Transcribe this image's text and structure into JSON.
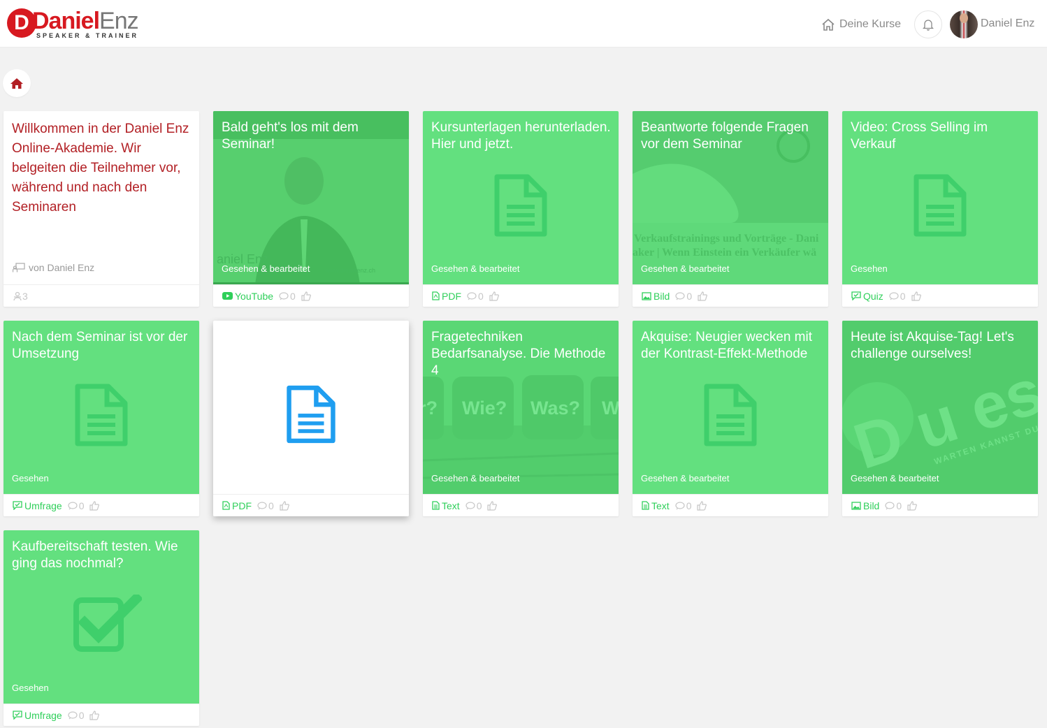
{
  "header": {
    "logo_main": "Daniel",
    "logo_enz": "Enz",
    "logo_sub": "SPEAKER & TRAINER",
    "nav_courses": "Deine Kurse",
    "user_name": "Daniel Enz"
  },
  "welcome": {
    "title": "Willkommen in der Daniel Enz Online-Akademie. Wir belgeiten die Teilnehmer vor, während und nach den Seminaren",
    "author": "von Daniel Enz",
    "members": "3"
  },
  "cards": [
    {
      "title": "Bald geht's los mit dem Seminar!",
      "status": "Gesehen & bearbeitet",
      "type": "YouTube",
      "comments": "0",
      "image_text": "aniel Enz",
      "image_url_text": "www.danielenz.ch"
    },
    {
      "title": "Kursunterlagen herunterladen. Hier und jetzt.",
      "status": "Gesehen & bearbeitet",
      "type": "PDF",
      "comments": "0"
    },
    {
      "title": "Beantworte folgende Fragen vor dem Seminar",
      "status": "Gesehen & bearbeitet",
      "type": "Bild",
      "comments": "0",
      "image_line1": "Verkaufstrainings und Vorträge - Dani",
      "image_line2": "aker | Wenn Einstein ein Verkäufer wä"
    },
    {
      "title": "Video: Cross Selling im Verkauf",
      "status": "Gesehen",
      "type": "Quiz",
      "comments": "0"
    },
    {
      "title": "Nach dem Seminar ist vor der Umsetzung",
      "status": "Gesehen",
      "type": "Umfrage",
      "comments": "0"
    },
    {
      "title": "",
      "status": "",
      "type": "PDF",
      "comments": "0"
    },
    {
      "title": "Fragetechniken Bedarfsanalyse. Die Methode 4",
      "status": "Gesehen & bearbeitet",
      "type": "Text",
      "comments": "0",
      "dice": [
        "r?",
        "Wie?",
        "Was?",
        "W"
      ]
    },
    {
      "title": "Akquise: Neugier wecken mit der Kontrast-Effekt-Methode",
      "status": "Gesehen & bearbeitet",
      "type": "Text",
      "comments": "0"
    },
    {
      "title": "Heute ist Akquise-Tag! Let's challenge ourselves!",
      "status": "Gesehen & bearbeitet",
      "type": "Bild",
      "comments": "0",
      "image_big": "D u es",
      "image_small": "WARTEN KANNST DU MO"
    },
    {
      "title": "Kaufbereitschaft testen. Wie ging das nochmal?",
      "status": "Gesehen",
      "type": "Umfrage",
      "comments": "0"
    }
  ],
  "colors": {
    "accent_red": "#d71920",
    "card_green": "#63e07f",
    "type_green": "#2fcf5a",
    "pdf_blue": "#1f9ef0"
  }
}
